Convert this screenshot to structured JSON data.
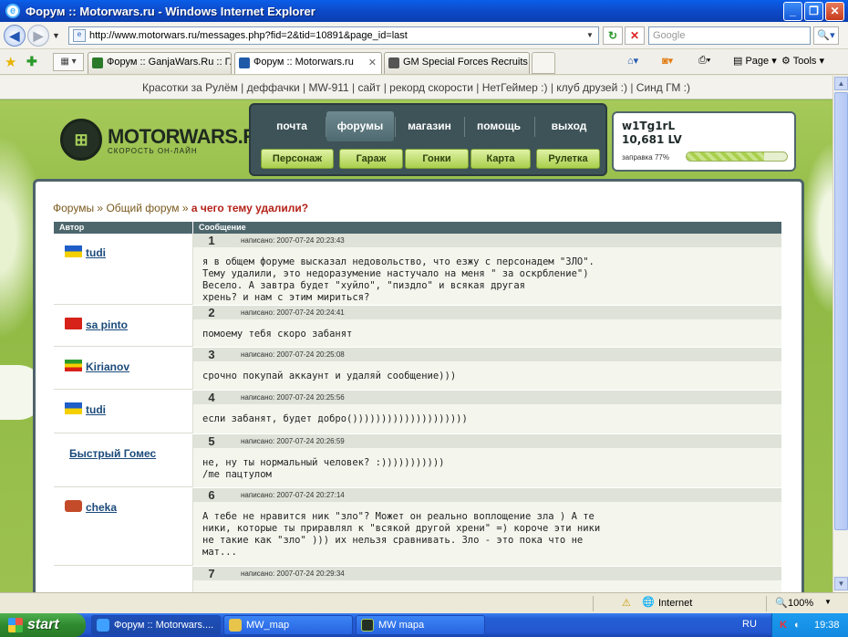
{
  "window": {
    "title": "Форум :: Motorwars.ru - Windows Internet Explorer"
  },
  "toolbar": {
    "url": "http://www.motorwars.ru/messages.php?fid=2&tid=10891&page_id=last",
    "search_placeholder": "Google"
  },
  "tabs": [
    {
      "label": "Форум :: GanjaWars.Ru :: Г..."
    },
    {
      "label": "Форум :: Motorwars.ru"
    },
    {
      "label": "GM Special Forces Recruits #..."
    }
  ],
  "commandbar": {
    "page_label": "Page",
    "tools_label": "Tools"
  },
  "site": {
    "toplinks": [
      "Красотки за Рулём",
      "деффачки",
      "MW-911",
      "сайт",
      "рекорд скорости",
      "НетГеймер :)",
      "клуб друзей :)",
      "Синд ГМ :)"
    ],
    "logo_name": "MOTORWARS.RU",
    "logo_sub": "СКОРОСТЬ ОН-ЛАЙН",
    "nav_top": [
      "почта",
      "форумы",
      "магазин",
      "помощь",
      "выход"
    ],
    "nav_bottom": [
      "Персонаж",
      "Гараж",
      "Гонки",
      "Карта",
      "Рулетка"
    ],
    "user": {
      "name": "w1Tg1rL",
      "level": "10,681 LV",
      "fuel_label": "заправка 77%",
      "fuel_fraction": 0.77
    }
  },
  "breadcrumb": {
    "forums": "Форумы",
    "sep1": "»",
    "general": "Общий форум",
    "sep2": "»",
    "current": "а чего тему удалили?"
  },
  "table": {
    "col_author": "Автор",
    "col_message": "Сообщение"
  },
  "posts": [
    {
      "num": "1",
      "author": "tudi",
      "flag": "ua",
      "date": "написано: 2007-07-24 20:23:43",
      "text": "я в общем форуме высказал недовольство, что езжу с персонадем \"ЗЛО\".\nТему удалили, это недоразумение настучало на меня \" за оскрбление\")\nВесело. А завтра будет \"хуйло\", \"пиздло\" и всякая другая\nхрень? и нам с этим мириться?"
    },
    {
      "num": "2",
      "author": "sa pinto",
      "flag": "kg",
      "date": "написано: 2007-07-24 20:24:41",
      "text": "помоему тебя скоро забанят"
    },
    {
      "num": "3",
      "author": "Kirianov",
      "flag": "et",
      "date": "написано: 2007-07-24 20:25:08",
      "text": "срочно покупай аккаунт и удаляй сообщение)))"
    },
    {
      "num": "4",
      "author": "tudi",
      "flag": "ua",
      "date": "написано: 2007-07-24 20:25:56",
      "text": "если забанят, будет добро())))))))))))))))))))"
    },
    {
      "num": "5",
      "author": "Быстрый Гомес",
      "flag": "",
      "date": "написано: 2007-07-24 20:26:59",
      "text": "не, ну ты нормальный человек? :)))))))))))\n/me пацтулом"
    },
    {
      "num": "6",
      "author": "cheka",
      "flag": "cheka",
      "date": "написано: 2007-07-24 20:27:14",
      "text": "А тебе не нравится ник \"зло\"? Может он реально воплощение зла ) А те\nники, которые ты приравлял к \"всякой другой хрени\" =) короче эти ники\nне такие как \"зло\" ))) их нельзя сравнивать. Зло - это пока что не\nмат..."
    },
    {
      "num": "7",
      "author": "",
      "flag": "",
      "date": "написано: 2007-07-24 20:29:34",
      "text": ""
    }
  ],
  "statusbar": {
    "zone": "Internet",
    "zoom": "100%"
  },
  "taskbar": {
    "start": "start",
    "items": [
      "Форум :: Motorwars....",
      "MW_map",
      "MW mapa"
    ],
    "lang": "RU",
    "clock": "19:38"
  }
}
